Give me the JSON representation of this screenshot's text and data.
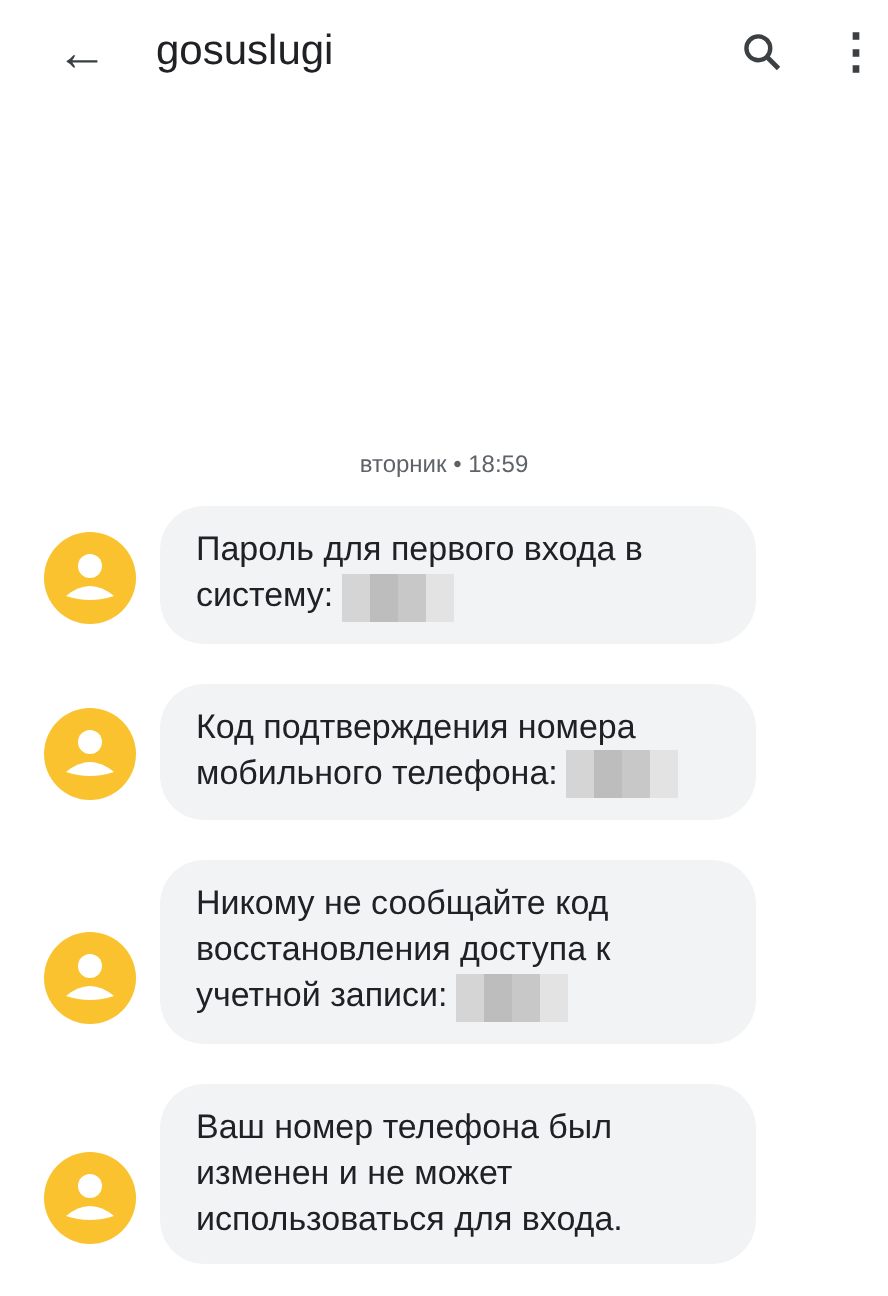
{
  "header": {
    "back": "←",
    "title": "gosuslugi",
    "menu": "⋮"
  },
  "date_divider": "вторник • 18:59",
  "messages": [
    {
      "text": "Пароль для первого входа в систему:",
      "redacted": true
    },
    {
      "text": "Код подтверждения номера мобильного телефона:",
      "redacted": true
    },
    {
      "text": "Никому не сообщайте код восстановления доступа к учетной записи:",
      "redacted": true
    },
    {
      "text": "Ваш номер телефона был изменен и не может использоваться для входа.",
      "redacted": false
    }
  ]
}
